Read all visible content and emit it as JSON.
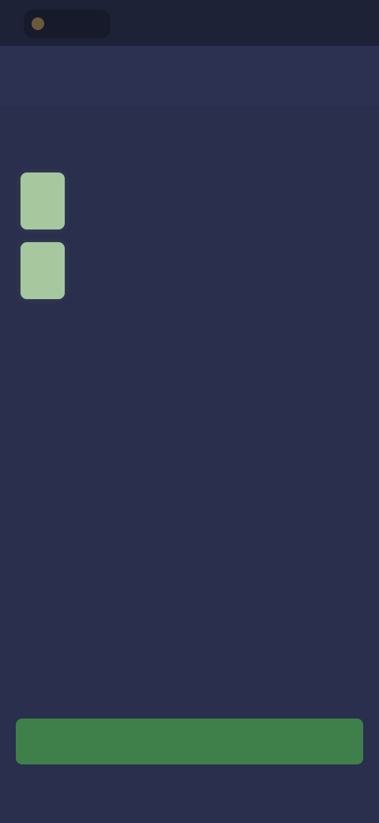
{
  "status_bar": {
    "left_text": "",
    "right_text": ""
  },
  "header": {
    "title": "",
    "action_label": ""
  },
  "section": {
    "label": "",
    "action_label": ""
  },
  "list": {
    "items": [
      {
        "title": "",
        "subtitle": ""
      },
      {
        "title": "",
        "subtitle": ""
      }
    ]
  },
  "footer": {
    "button_label": ""
  },
  "colors": {
    "background": "#2a2f4d",
    "header_bg": "#2c3152",
    "accent_green": "#3f7f4a",
    "thumbnail_green": "#a7c79e"
  }
}
